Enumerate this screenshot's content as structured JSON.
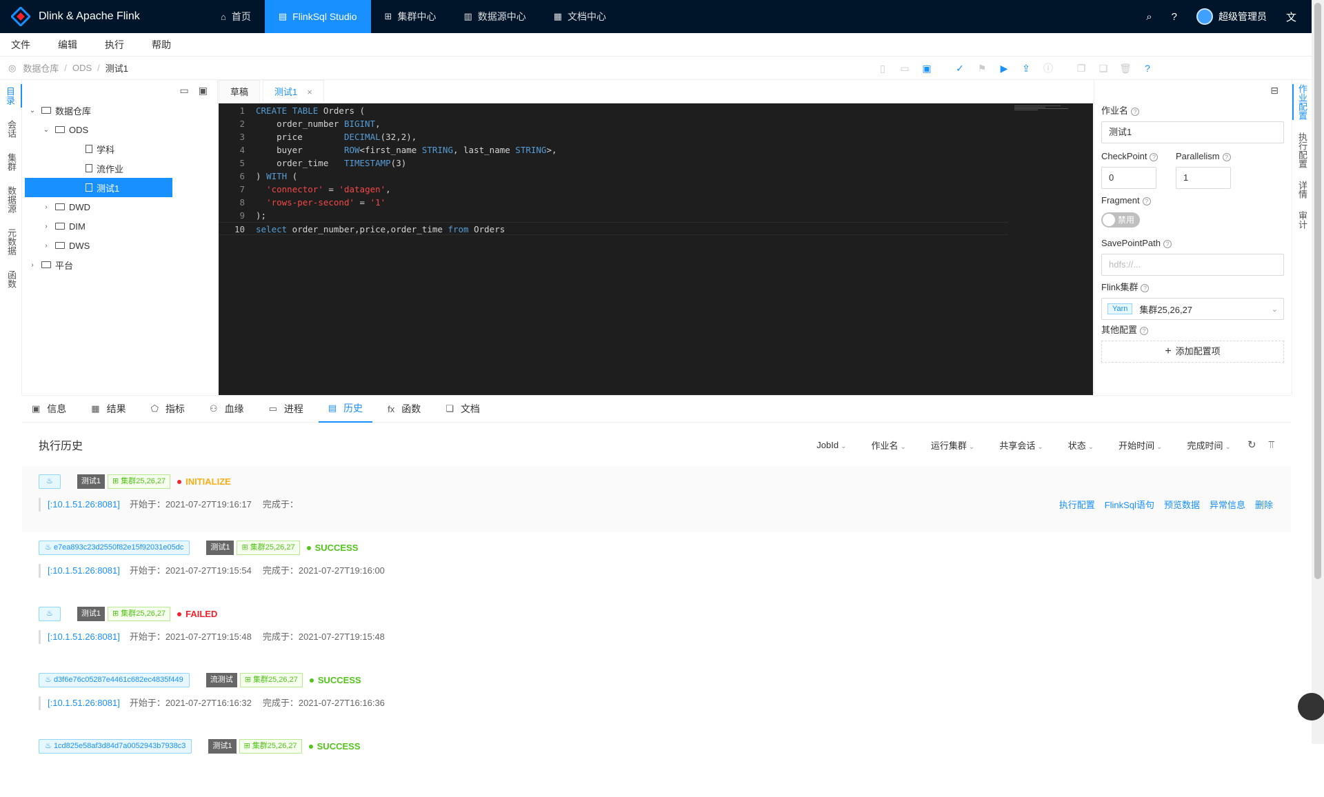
{
  "app": {
    "brand": "Dlink & Apache Flink",
    "nav": [
      {
        "icon": "home-icon",
        "label": "首页",
        "active": false
      },
      {
        "icon": "studio-icon",
        "label": "FlinkSql Studio",
        "active": true
      },
      {
        "icon": "cluster-icon",
        "label": "集群中心",
        "active": false
      },
      {
        "icon": "datasource-icon",
        "label": "数据源中心",
        "active": false
      },
      {
        "icon": "doc-icon",
        "label": "文档中心",
        "active": false
      }
    ],
    "user": "超级管理员"
  },
  "menu": [
    "文件",
    "编辑",
    "执行",
    "帮助"
  ],
  "breadcrumb": [
    "数据仓库",
    "ODS",
    "测试1"
  ],
  "left_tabs": [
    "目录",
    "会话",
    "集群",
    "数据源",
    "元数据",
    "函数"
  ],
  "tree": [
    {
      "label": "数据仓库",
      "level": 0,
      "type": "folder",
      "expanded": true
    },
    {
      "label": "ODS",
      "level": 1,
      "type": "folder",
      "expanded": true
    },
    {
      "label": "学科",
      "level": 2,
      "type": "file"
    },
    {
      "label": "流作业",
      "level": 2,
      "type": "file"
    },
    {
      "label": "测试1",
      "level": 2,
      "type": "file",
      "selected": true
    },
    {
      "label": "DWD",
      "level": 1,
      "type": "folder",
      "expanded": false
    },
    {
      "label": "DIM",
      "level": 1,
      "type": "folder",
      "expanded": false
    },
    {
      "label": "DWS",
      "level": 1,
      "type": "folder",
      "expanded": false
    },
    {
      "label": "平台",
      "level": 0,
      "type": "folder",
      "expanded": false
    }
  ],
  "editor_tabs": [
    {
      "label": "草稿",
      "active": false
    },
    {
      "label": "测试1",
      "active": true
    }
  ],
  "code_lines": [
    "CREATE TABLE Orders (",
    "    order_number BIGINT,",
    "    price        DECIMAL(32,2),",
    "    buyer        ROW<first_name STRING, last_name STRING>,",
    "    order_time   TIMESTAMP(3)",
    ") WITH (",
    "  'connector' = 'datagen',",
    "  'rows-per-second' = '1'",
    ");",
    "select order_number,price,order_time from Orders"
  ],
  "config": {
    "job_name_label": "作业名",
    "job_name": "测试1",
    "checkpoint_label": "CheckPoint",
    "checkpoint": "0",
    "parallelism_label": "Parallelism",
    "parallelism": "1",
    "fragment_label": "Fragment",
    "fragment_toggle": "禁用",
    "savepoint_label": "SavePointPath",
    "savepoint_placeholder": "hdfs://...",
    "cluster_label": "Flink集群",
    "cluster_tag": "Yarn",
    "cluster_value": "集群25,26,27",
    "other_label": "其他配置",
    "add_config": "添加配置项"
  },
  "right_tabs": [
    "作业配置",
    "执行配置",
    "详情",
    "审计"
  ],
  "bottom_tabs": [
    {
      "icon": "info-icon",
      "label": "信息"
    },
    {
      "icon": "table-icon",
      "label": "结果"
    },
    {
      "icon": "metrics-icon",
      "label": "指标"
    },
    {
      "icon": "lineage-icon",
      "label": "血缘"
    },
    {
      "icon": "process-icon",
      "label": "进程"
    },
    {
      "icon": "history-icon",
      "label": "历史",
      "active": true
    },
    {
      "icon": "function-icon",
      "label": "函数"
    },
    {
      "icon": "document-icon",
      "label": "文档"
    }
  ],
  "history": {
    "title": "执行历史",
    "filters": [
      "JobId",
      "作业名",
      "运行集群",
      "共享会话",
      "状态",
      "开始时间",
      "完成时间"
    ],
    "actions": [
      "执行配置",
      "FlinkSql语句",
      "预览数据",
      "异常信息",
      "删除"
    ],
    "items": [
      {
        "jobid": "",
        "job": "测试1",
        "cluster": "集群25,26,27",
        "status": "INITIALIZE",
        "status_class": "init",
        "addr": "[:10.1.51.26:8081]",
        "start": "开始于：2021-07-27T19:16:17",
        "end": "完成于：",
        "highlight": true
      },
      {
        "jobid": "e7ea893c23d2550f82e15f92031e05dc",
        "job": "测试1",
        "cluster": "集群25,26,27",
        "status": "SUCCESS",
        "status_class": "ok",
        "addr": "[:10.1.51.26:8081]",
        "start": "开始于：2021-07-27T19:15:54",
        "end": "完成于：2021-07-27T19:16:00"
      },
      {
        "jobid": "",
        "job": "测试1",
        "cluster": "集群25,26,27",
        "status": "FAILED",
        "status_class": "fail",
        "addr": "[:10.1.51.26:8081]",
        "start": "开始于：2021-07-27T19:15:48",
        "end": "完成于：2021-07-27T19:15:48"
      },
      {
        "jobid": "d3f6e76c05287e4461c682ec4835f449",
        "job": "流测试",
        "cluster": "集群25,26,27",
        "status": "SUCCESS",
        "status_class": "ok",
        "addr": "[:10.1.51.26:8081]",
        "start": "开始于：2021-07-27T16:16:32",
        "end": "完成于：2021-07-27T16:16:36"
      },
      {
        "jobid": "1cd825e58af3d84d7a0052943b7938c3",
        "job": "测试1",
        "cluster": "集群25,26,27",
        "status": "SUCCESS",
        "status_class": "ok",
        "addr": "",
        "start": "",
        "end": ""
      }
    ]
  }
}
